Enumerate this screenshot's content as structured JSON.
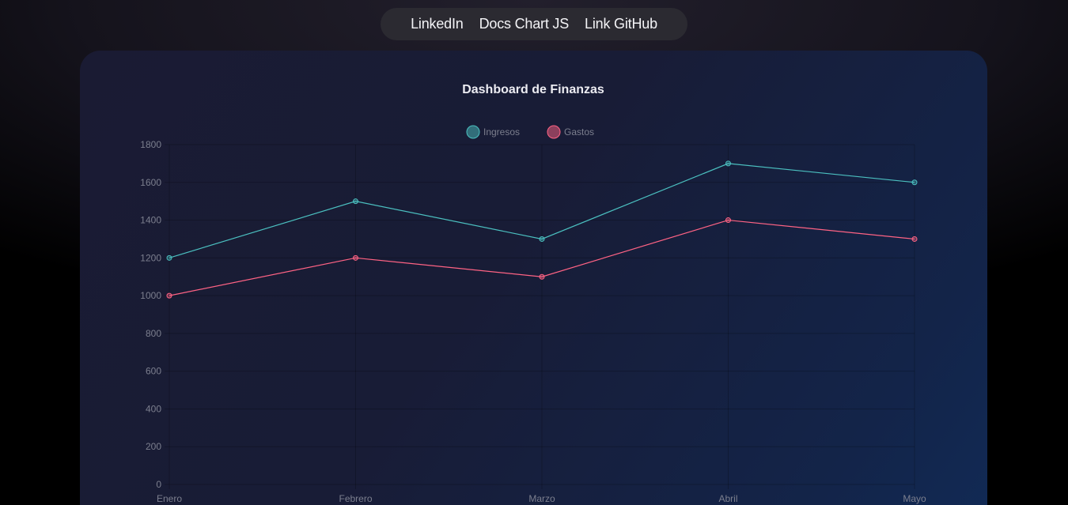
{
  "nav": {
    "links": [
      {
        "label": "LinkedIn"
      },
      {
        "label": "Docs Chart JS"
      },
      {
        "label": "Link GitHub"
      }
    ]
  },
  "chart_data": {
    "type": "line",
    "title": "Dashboard de Finanzas",
    "categories": [
      "Enero",
      "Febrero",
      "Marzo",
      "Abril",
      "Mayo"
    ],
    "series": [
      {
        "name": "Ingresos",
        "values": [
          1200,
          1500,
          1300,
          1700,
          1600
        ],
        "color": "#4bc0c0"
      },
      {
        "name": "Gastos",
        "values": [
          1000,
          1200,
          1100,
          1400,
          1300
        ],
        "color": "#ff6384"
      }
    ],
    "ylim": [
      0,
      1800
    ],
    "yticks": [
      0,
      200,
      400,
      600,
      800,
      1000,
      1200,
      1400,
      1600,
      1800
    ],
    "grid": true,
    "legend": "top"
  }
}
